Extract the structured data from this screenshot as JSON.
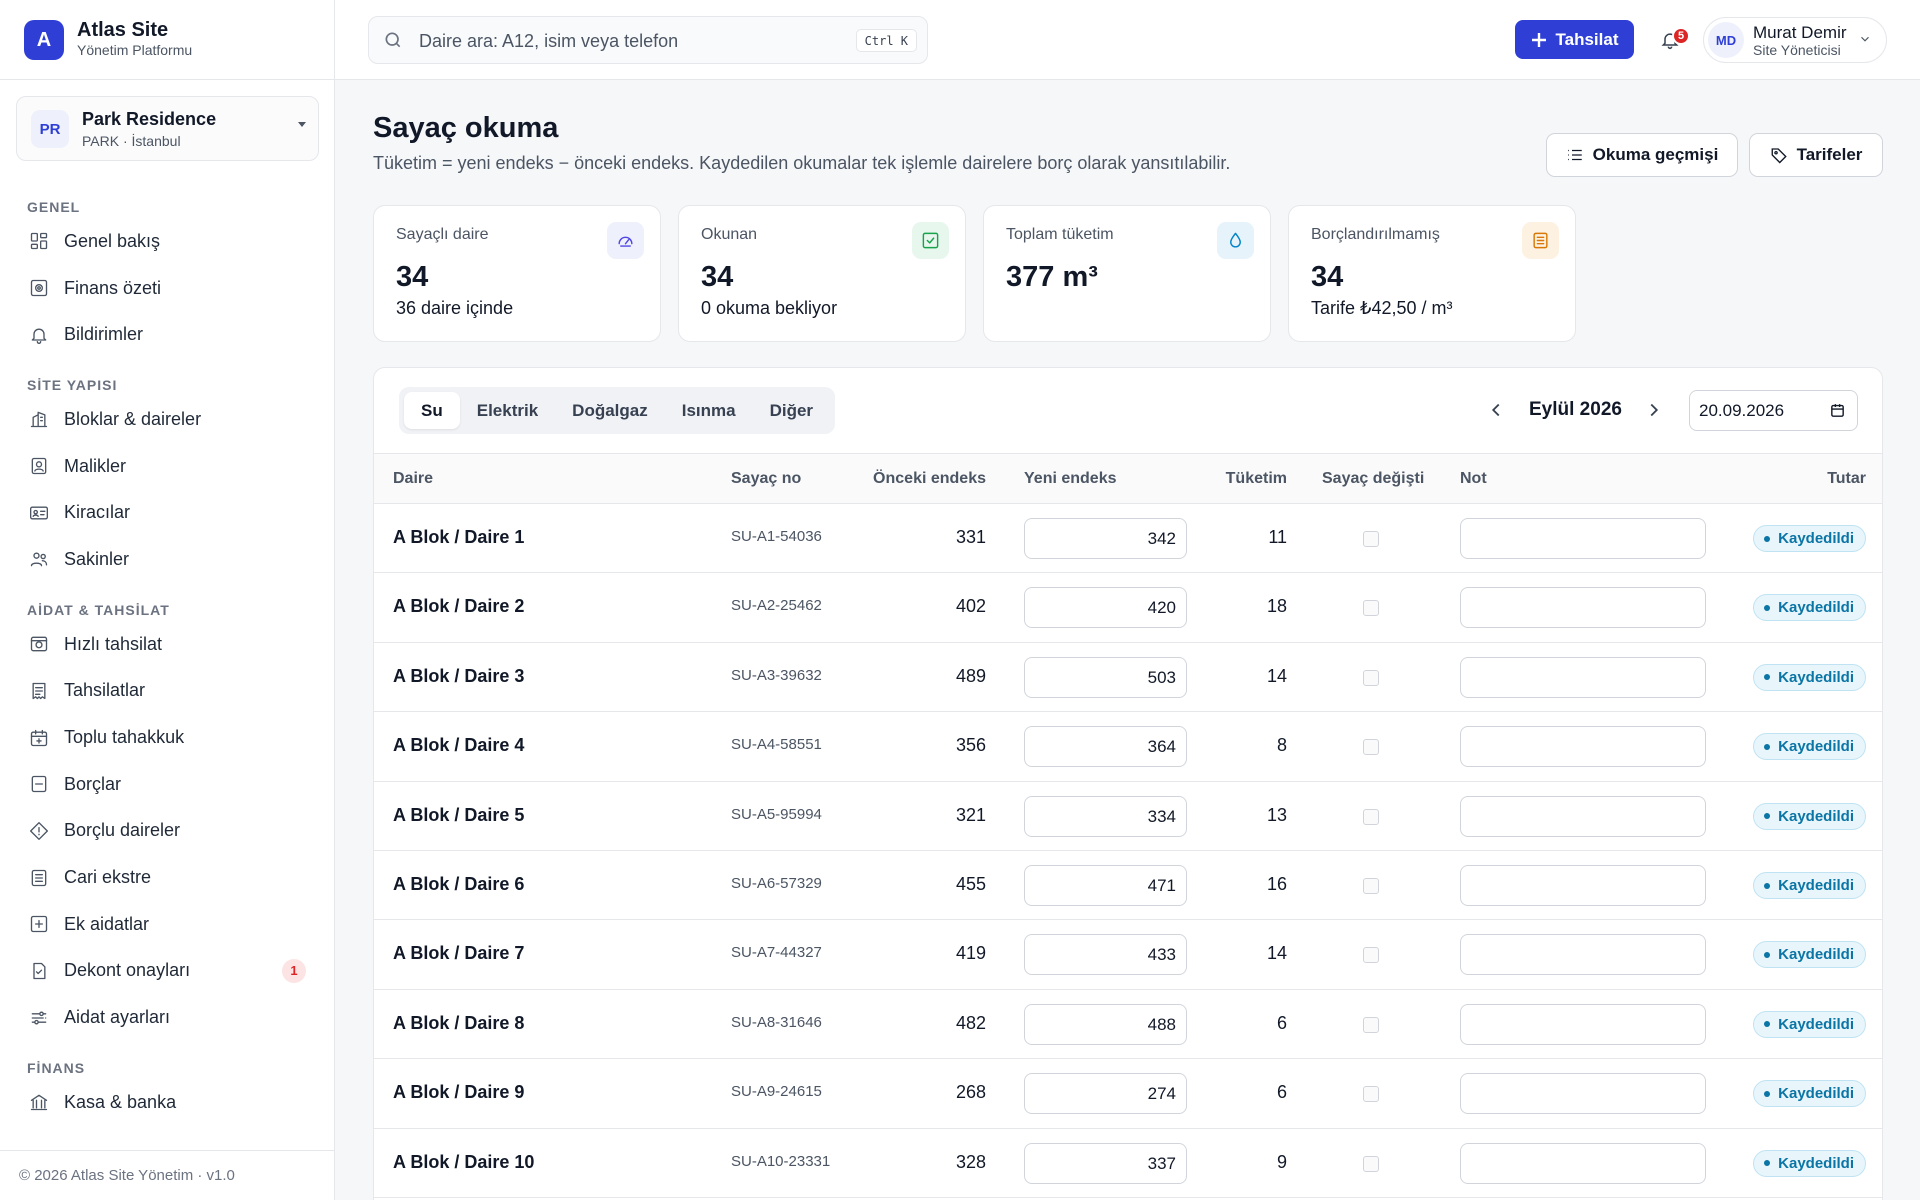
{
  "brand": {
    "logo_letter": "A",
    "name": "Atlas Site",
    "subtitle": "Yönetim Platformu"
  },
  "site": {
    "initials": "PR",
    "name": "Park Residence",
    "location": "PARK · İstanbul"
  },
  "nav": {
    "sections": [
      {
        "title": "GENEL",
        "items": [
          {
            "label": "Genel bakış",
            "icon": "dashboard-icon"
          },
          {
            "label": "Finans özeti",
            "icon": "finance-icon"
          },
          {
            "label": "Bildirimler",
            "icon": "bell-icon"
          }
        ]
      },
      {
        "title": "SİTE YAPISI",
        "items": [
          {
            "label": "Bloklar & daireler",
            "icon": "building-icon"
          },
          {
            "label": "Malikler",
            "icon": "owner-icon"
          },
          {
            "label": "Kiracılar",
            "icon": "id-card-icon"
          },
          {
            "label": "Sakinler",
            "icon": "users-icon"
          }
        ]
      },
      {
        "title": "AİDAT & TAHSİLAT",
        "items": [
          {
            "label": "Hızlı tahsilat",
            "icon": "quick-payment-icon"
          },
          {
            "label": "Tahsilatlar",
            "icon": "receipt-icon"
          },
          {
            "label": "Toplu tahakkuk",
            "icon": "calendar-plus-icon"
          },
          {
            "label": "Borçlar",
            "icon": "debt-icon"
          },
          {
            "label": "Borçlu daireler",
            "icon": "alert-diamond-icon"
          },
          {
            "label": "Cari ekstre",
            "icon": "statement-icon"
          },
          {
            "label": "Ek aidatlar",
            "icon": "plus-square-icon"
          },
          {
            "label": "Dekont onayları",
            "icon": "document-check-icon",
            "badge": "1"
          },
          {
            "label": "Aidat ayarları",
            "icon": "sliders-icon"
          }
        ]
      },
      {
        "title": "FİNANS",
        "items": [
          {
            "label": "Kasa & banka",
            "icon": "bank-icon"
          }
        ]
      }
    ]
  },
  "footer": "© 2026 Atlas Site Yönetim · v1.0",
  "topbar": {
    "search_placeholder": "Daire ara: A12, isim veya telefon",
    "search_shortcut": "Ctrl K",
    "primary_action": "Tahsilat",
    "notification_count": "5",
    "user": {
      "initials": "MD",
      "name": "Murat Demir",
      "role": "Site Yöneticisi"
    }
  },
  "page": {
    "title": "Sayaç okuma",
    "description": "Tüketim = yeni endeks − önceki endeks. Kaydedilen okumalar tek işlemle dairelere borç olarak yansıtılabilir.",
    "history_button": "Okuma geçmişi",
    "tariffs_button": "Tarifeler"
  },
  "stats": [
    {
      "label": "Sayaçlı daire",
      "value": "34",
      "sub": "36 daire içinde",
      "icon": "gauge-icon",
      "color": "#4f46e5",
      "bg": "#eef0fb"
    },
    {
      "label": "Okunan",
      "value": "34",
      "sub": "0 okuma bekliyor",
      "icon": "check-square-icon",
      "color": "#16a34a",
      "bg": "#e8f7ee"
    },
    {
      "label": "Toplam tüketim",
      "value": "377 m³",
      "sub": "",
      "icon": "droplet-icon",
      "color": "#0284c7",
      "bg": "#e6f3fb"
    },
    {
      "label": "Borçlandırılmamış",
      "value": "34",
      "sub": "Tarife ₺42,50 / m³",
      "icon": "invoice-icon",
      "color": "#d97706",
      "bg": "#fdf1e2"
    }
  ],
  "tabs": [
    "Su",
    "Elektrik",
    "Doğalgaz",
    "Isınma",
    "Diğer"
  ],
  "active_tab": "Su",
  "period": {
    "label": "Eylül 2026",
    "date": "20.09.2026"
  },
  "table": {
    "columns": [
      "Daire",
      "Sayaç no",
      "Önceki endeks",
      "Yeni endeks",
      "Tüketim",
      "Sayaç değişti",
      "Not",
      "Tutar"
    ],
    "rows": [
      {
        "unit": "A Blok / Daire 1",
        "meter": "SU-A1-54036",
        "prev": "331",
        "new": "342",
        "cons": "11",
        "status": "Kaydedildi"
      },
      {
        "unit": "A Blok / Daire 2",
        "meter": "SU-A2-25462",
        "prev": "402",
        "new": "420",
        "cons": "18",
        "status": "Kaydedildi"
      },
      {
        "unit": "A Blok / Daire 3",
        "meter": "SU-A3-39632",
        "prev": "489",
        "new": "503",
        "cons": "14",
        "status": "Kaydedildi"
      },
      {
        "unit": "A Blok / Daire 4",
        "meter": "SU-A4-58551",
        "prev": "356",
        "new": "364",
        "cons": "8",
        "status": "Kaydedildi"
      },
      {
        "unit": "A Blok / Daire 5",
        "meter": "SU-A5-95994",
        "prev": "321",
        "new": "334",
        "cons": "13",
        "status": "Kaydedildi"
      },
      {
        "unit": "A Blok / Daire 6",
        "meter": "SU-A6-57329",
        "prev": "455",
        "new": "471",
        "cons": "16",
        "status": "Kaydedildi"
      },
      {
        "unit": "A Blok / Daire 7",
        "meter": "SU-A7-44327",
        "prev": "419",
        "new": "433",
        "cons": "14",
        "status": "Kaydedildi"
      },
      {
        "unit": "A Blok / Daire 8",
        "meter": "SU-A8-31646",
        "prev": "482",
        "new": "488",
        "cons": "6",
        "status": "Kaydedildi"
      },
      {
        "unit": "A Blok / Daire 9",
        "meter": "SU-A9-24615",
        "prev": "268",
        "new": "274",
        "cons": "6",
        "status": "Kaydedildi"
      },
      {
        "unit": "A Blok / Daire 10",
        "meter": "SU-A10-23331",
        "prev": "328",
        "new": "337",
        "cons": "9",
        "status": "Kaydedildi"
      }
    ]
  }
}
